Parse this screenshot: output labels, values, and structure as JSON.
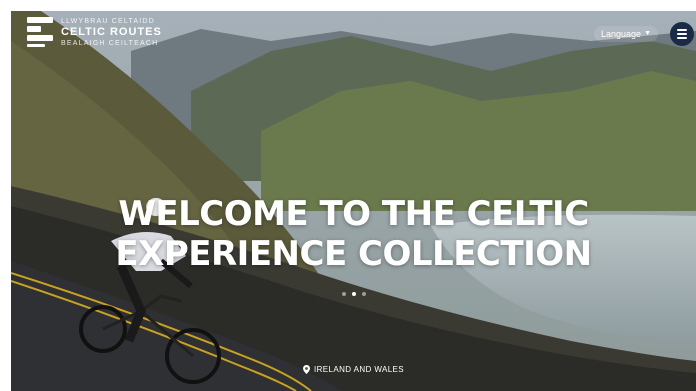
{
  "logo": {
    "welsh_line": "LLWYBRAU CELTAIDD",
    "title": "CELTIC ROUTES",
    "irish_line": "BEALAIGH CEILTEACH"
  },
  "header": {
    "language_label": "Language",
    "language_icon": "chevron-down-icon",
    "menu_icon": "hamburger-icon"
  },
  "hero": {
    "headline_line1": "WELCOME TO THE CELTIC",
    "headline_line2": "EXPERIENCE COLLECTION",
    "location_icon": "map-pin-icon",
    "location": "IRELAND AND WALES",
    "slides_total": 3,
    "active_slide": 2
  },
  "colors": {
    "menu_button_bg": "#1b2a46",
    "text": "#ffffff"
  }
}
